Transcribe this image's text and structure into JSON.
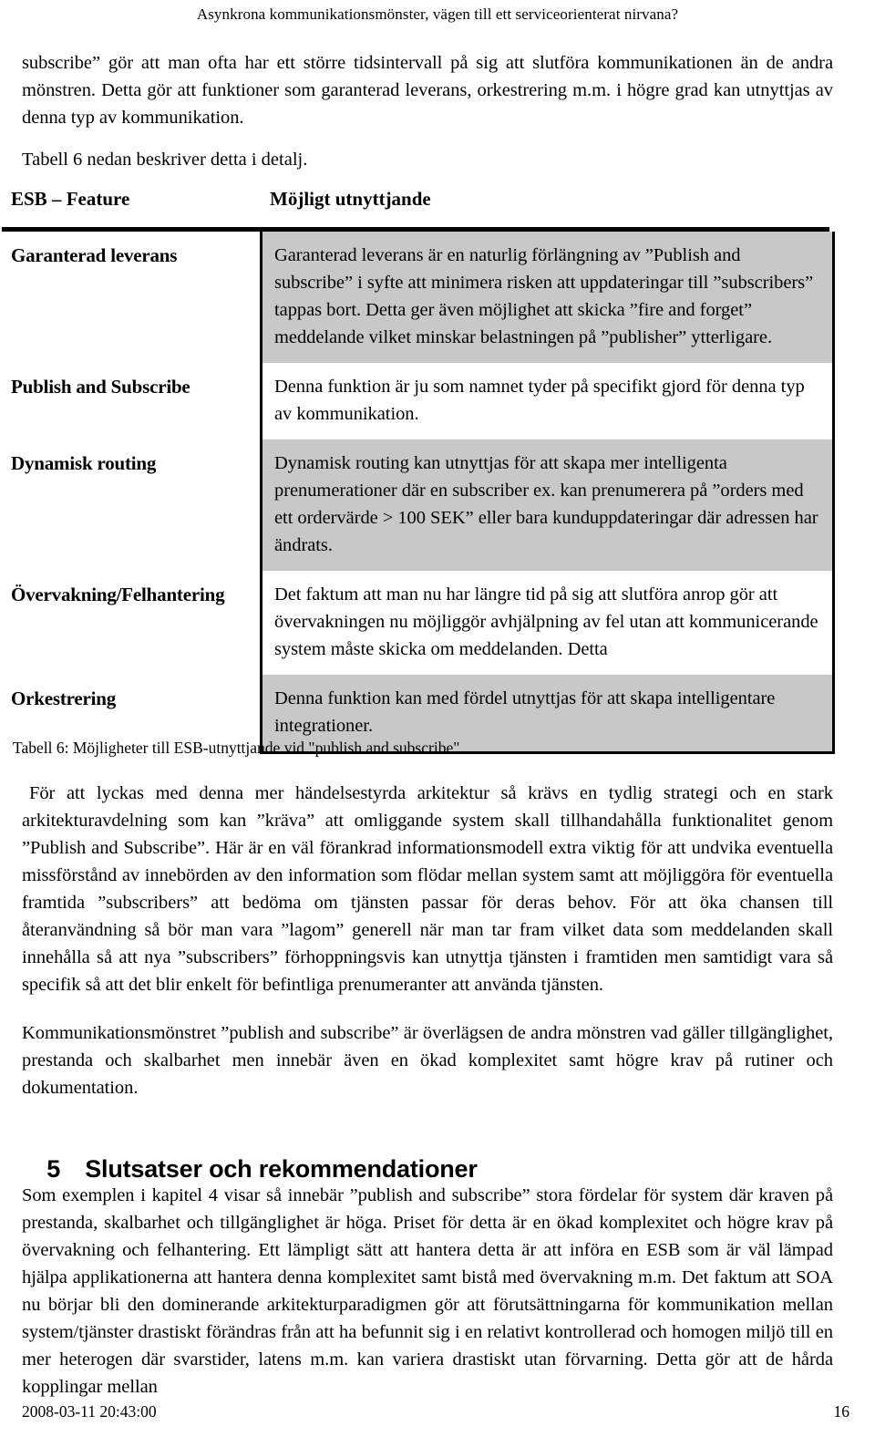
{
  "header": {
    "running_title": "Asynkrona kommunikationsmönster, vägen till ett serviceorienterat nirvana?"
  },
  "intro": {
    "paragraph": "subscribe” gör att man ofta har ett större tidsintervall på sig att slutföra kommunikationen än de andra mönstren. Detta gör att funktioner som garanterad leverans, orkestrering m.m. i högre grad kan utnyttjas av denna typ av kommunikation.",
    "table_reference": "Tabell 6 nedan beskriver detta i detalj."
  },
  "table": {
    "headers": {
      "feature": "ESB – Feature",
      "usage": "Möjligt utnyttjande"
    },
    "rows": [
      {
        "feature": "Garanterad leverans",
        "usage": "Garanterad leverans är en naturlig förlängning av ”Publish and subscribe” i syfte att minimera risken att uppdateringar till ”subscribers” tappas bort. Detta ger även möjlighet att skicka ”fire and forget” meddelande vilket minskar belastningen på ”publisher” ytterligare.",
        "shaded": true
      },
      {
        "feature": "Publish and Subscribe",
        "usage": "Denna funktion är ju som namnet tyder på specifikt gjord för denna typ av kommunikation.",
        "shaded": false
      },
      {
        "feature": "Dynamisk routing",
        "usage": "Dynamisk routing kan utnyttjas för att skapa mer intelligenta prenumerationer där en subscriber ex. kan prenumerera på ”orders med ett ordervärde > 100 SEK” eller bara kunduppdateringar där adressen har ändrats.",
        "shaded": true
      },
      {
        "feature": "Övervakning/Felhantering",
        "usage": "Det faktum att man nu har längre tid på sig att slutföra anrop gör att övervakningen nu möjliggör avhjälpning av fel utan att kommunicerande system måste skicka om meddelanden. Detta",
        "shaded": false
      },
      {
        "feature": "Orkestrering",
        "usage": "Denna funktion kan med fördel utnyttjas för att skapa intelligentare integrationer.",
        "shaded": true
      }
    ],
    "caption": "Tabell 6: Möjligheter till ESB-utnyttjande vid \"publish and subscribe\""
  },
  "body": {
    "paragraph_a": "För att lyckas med denna mer händelsestyrda arkitektur så krävs en tydlig strategi och en stark arkitekturavdelning som kan ”kräva” att omliggande system skall tillhandahålla funktionalitet genom ”Publish and Subscribe”. Här är en väl förankrad informationsmodell extra viktig för att undvika eventuella missförstånd av innebörden av den information som flödar mellan system samt att möjliggöra för eventuella framtida ”subscribers” att bedöma om tjänsten passar för deras behov. För att öka chansen till återanvändning så bör man vara ”lagom” generell när man tar fram vilket data som meddelanden skall innehålla så att nya ”subscribers” förhoppningsvis kan utnyttja tjänsten i framtiden men samtidigt vara så specifik så att det blir enkelt för befintliga prenumeranter att använda tjänsten.",
    "paragraph_b": "Kommunikationsmönstret ”publish and subscribe” är överlägsen de andra mönstren vad gäller tillgänglighet, prestanda och skalbarhet men innebär även en ökad komplexitet samt högre krav på rutiner och dokumentation.",
    "paragraph_c": "Som exemplen i kapitel 4 visar så innebär ”publish and subscribe” stora fördelar för system där kraven på prestanda, skalbarhet och tillgänglighet är höga. Priset för detta är en ökad komplexitet och högre krav på övervakning och felhantering. Ett lämpligt sätt att hantera detta är att införa en ESB som är väl lämpad hjälpa applikationerna att hantera denna komplexitet samt bistå med övervakning m.m. Det faktum att SOA nu börjar bli den dominerande arkitekturparadigmen gör att förutsättningarna för kommunikation mellan system/tjänster drastiskt förändras från att ha befunnit sig i en relativt kontrollerad och homogen miljö till en mer heterogen där svarstider, latens m.m. kan variera drastiskt utan förvarning. Detta gör att de hårda kopplingar mellan"
  },
  "section": {
    "number": "5",
    "title": "Slutsatser och rekommendationer"
  },
  "footer": {
    "timestamp": "2008-03-11 20:43:00",
    "page_number": "16"
  }
}
